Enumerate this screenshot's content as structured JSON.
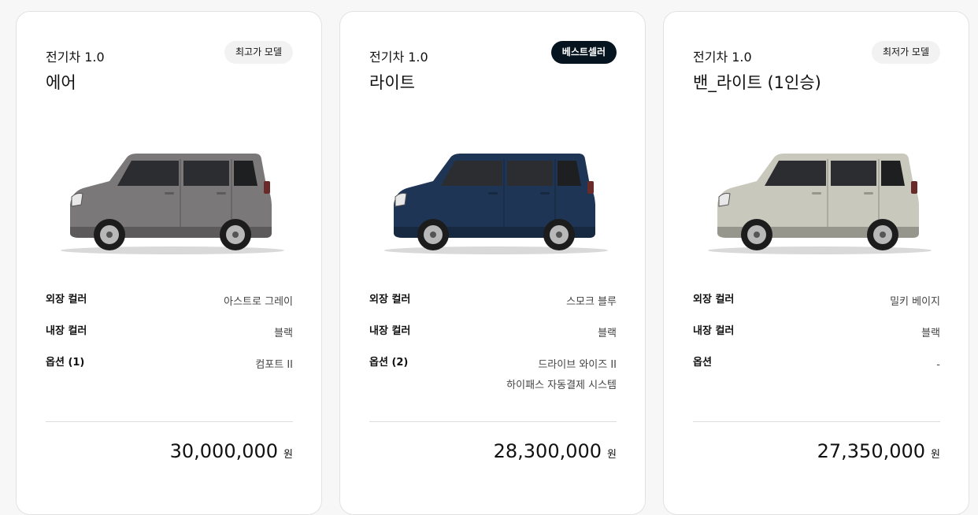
{
  "cards": [
    {
      "series": "전기차 1.0",
      "name": "에어",
      "badge": "최고가 모델",
      "car_color": "#7a7878",
      "exterior_label": "외장 컬러",
      "exterior_value": "아스트로 그레이",
      "interior_label": "내장 컬러",
      "interior_value": "블랙",
      "option_label": "옵션 (1)",
      "option_values": [
        "컴포트 II"
      ],
      "price": "30,000,000",
      "currency": "원"
    },
    {
      "series": "전기차 1.0",
      "name": "라이트",
      "badge": "베스트셀러",
      "car_color": "#1f3556",
      "exterior_label": "외장 컬러",
      "exterior_value": "스모크 블루",
      "interior_label": "내장 컬러",
      "interior_value": "블랙",
      "option_label": "옵션 (2)",
      "option_values": [
        "드라이브 와이즈 II",
        "하이패스 자동결제 시스템"
      ],
      "price": "28,300,000",
      "currency": "원"
    },
    {
      "series": "전기차 1.0",
      "name": "밴_라이트 (1인승)",
      "badge": "최저가 모델",
      "car_color": "#c9c8bc",
      "exterior_label": "외장 컬러",
      "exterior_value": "밀키 베이지",
      "interior_label": "내장 컬러",
      "interior_value": "블랙",
      "option_label": "옵션",
      "option_values": [
        "-"
      ],
      "price": "27,350,000",
      "currency": "원"
    }
  ]
}
